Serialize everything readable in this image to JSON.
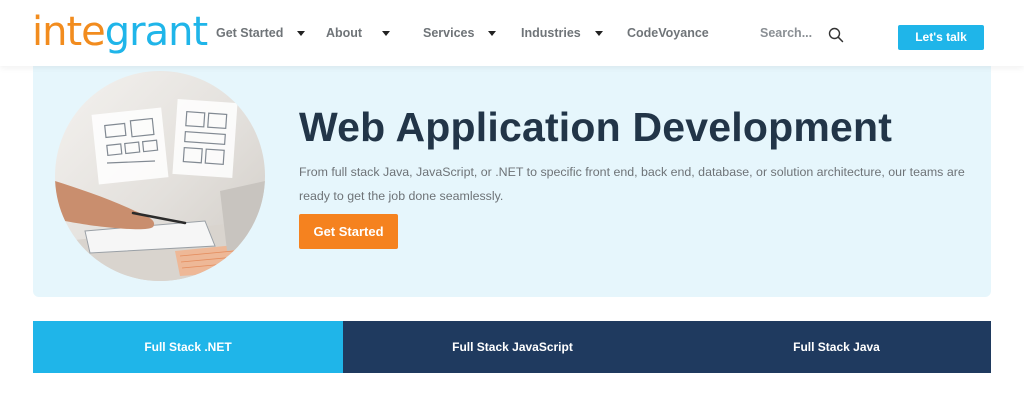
{
  "brand": {
    "logo_part1": "inte",
    "logo_part2": "grant",
    "colors": {
      "orange": "#f28c1e",
      "blue": "#1fb5e9",
      "navy": "#1f3a5f"
    }
  },
  "nav": {
    "items": [
      {
        "label": "Get Started",
        "has_dropdown": true
      },
      {
        "label": "About",
        "has_dropdown": true
      },
      {
        "label": "Services",
        "has_dropdown": true
      },
      {
        "label": "Industries",
        "has_dropdown": true
      },
      {
        "label": "CodeVoyance",
        "has_dropdown": false
      }
    ],
    "search_placeholder": "Search...",
    "search_icon": "search-icon",
    "cta_label": "Let's talk"
  },
  "hero": {
    "title": "Web Application Development",
    "description": "From full stack Java, JavaScript, or .NET to specific front end, back end, database, or solution architecture, our teams are ready to get the job done seamlessly.",
    "button_label": "Get Started"
  },
  "tabs": [
    {
      "label": "Full Stack .NET",
      "active": true
    },
    {
      "label": "Full Stack JavaScript",
      "active": false
    },
    {
      "label": "Full Stack Java",
      "active": false
    }
  ]
}
